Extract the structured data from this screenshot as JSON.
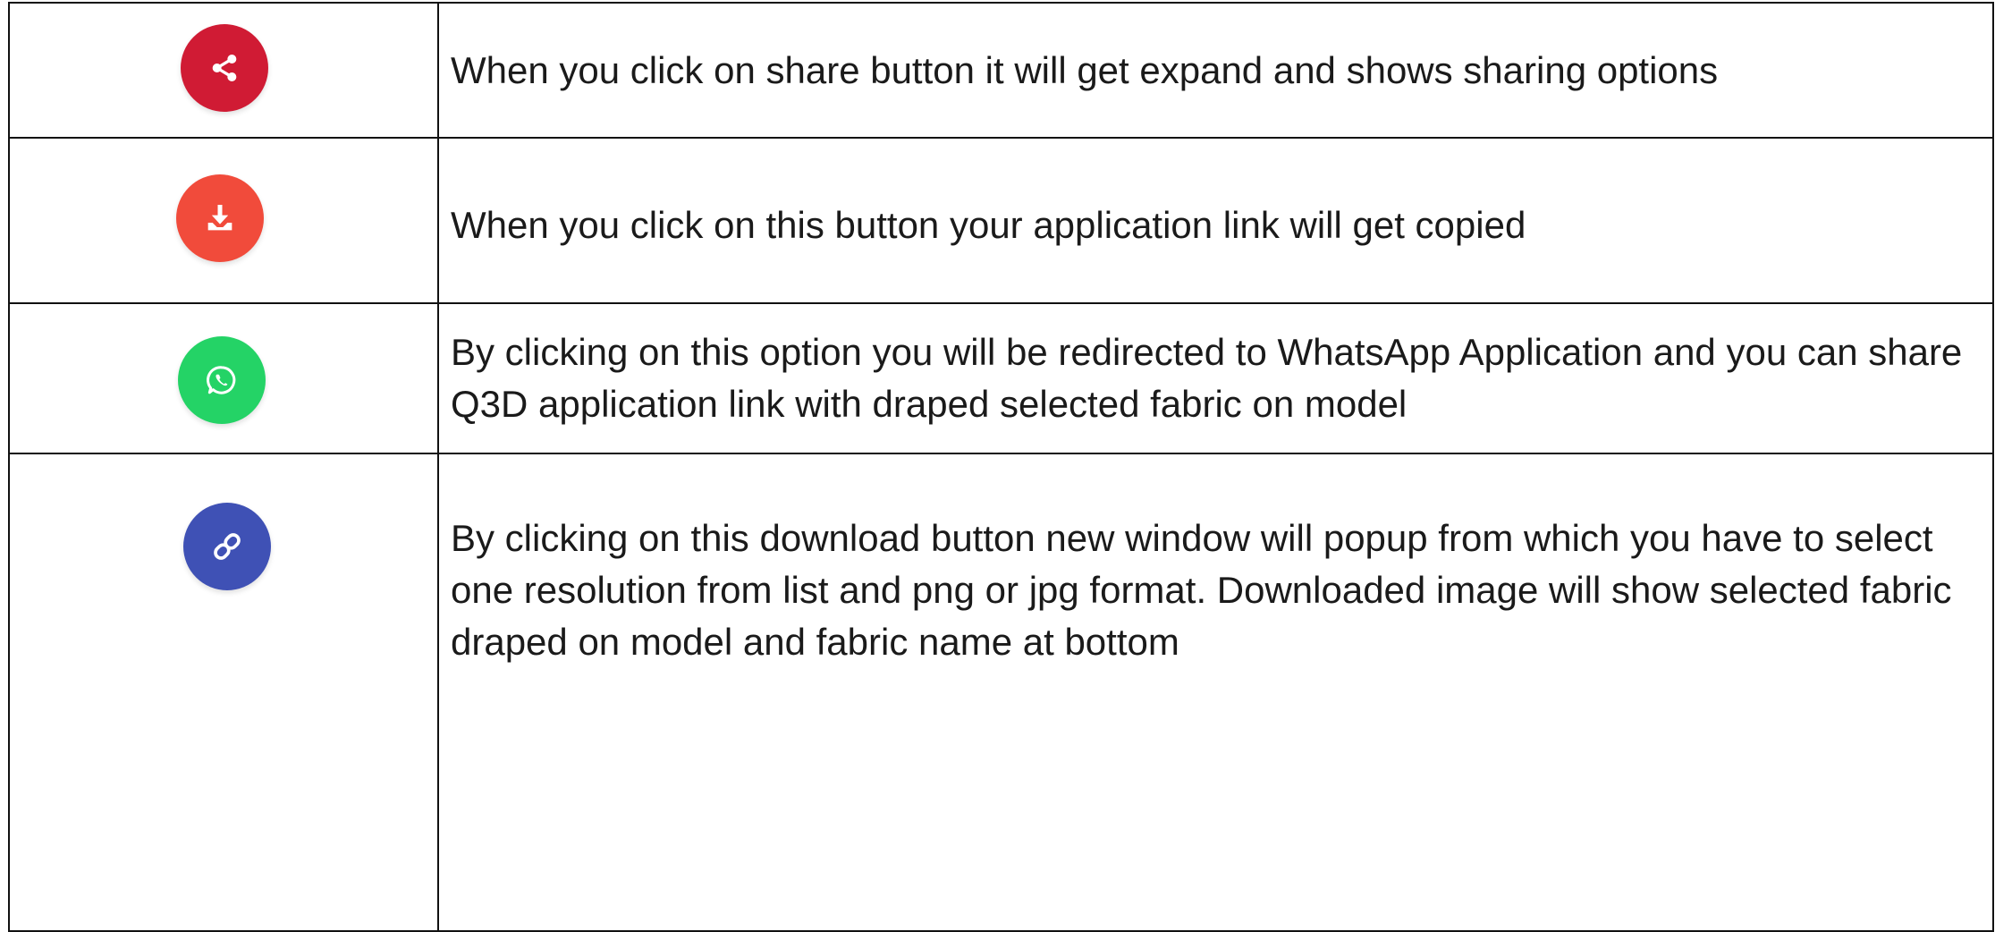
{
  "rows": [
    {
      "icon": "share-icon",
      "color": "#d01b34",
      "description": "When you click on share button it will get expand and shows sharing options"
    },
    {
      "icon": "download-icon",
      "color": "#f14b3b",
      "description": "When you click on this button your application link will get copied"
    },
    {
      "icon": "whatsapp-icon",
      "color": "#24d366",
      "description": "By clicking on this option you will be redirected to WhatsApp Application and you can share Q3D application link with draped selected fabric on model"
    },
    {
      "icon": "link-icon",
      "color": "#3f51b5",
      "description": "By clicking on this download button new window will popup from which you have to select one resolution from list and png or jpg format. Downloaded image will show selected fabric draped on model and fabric name at bottom"
    }
  ]
}
